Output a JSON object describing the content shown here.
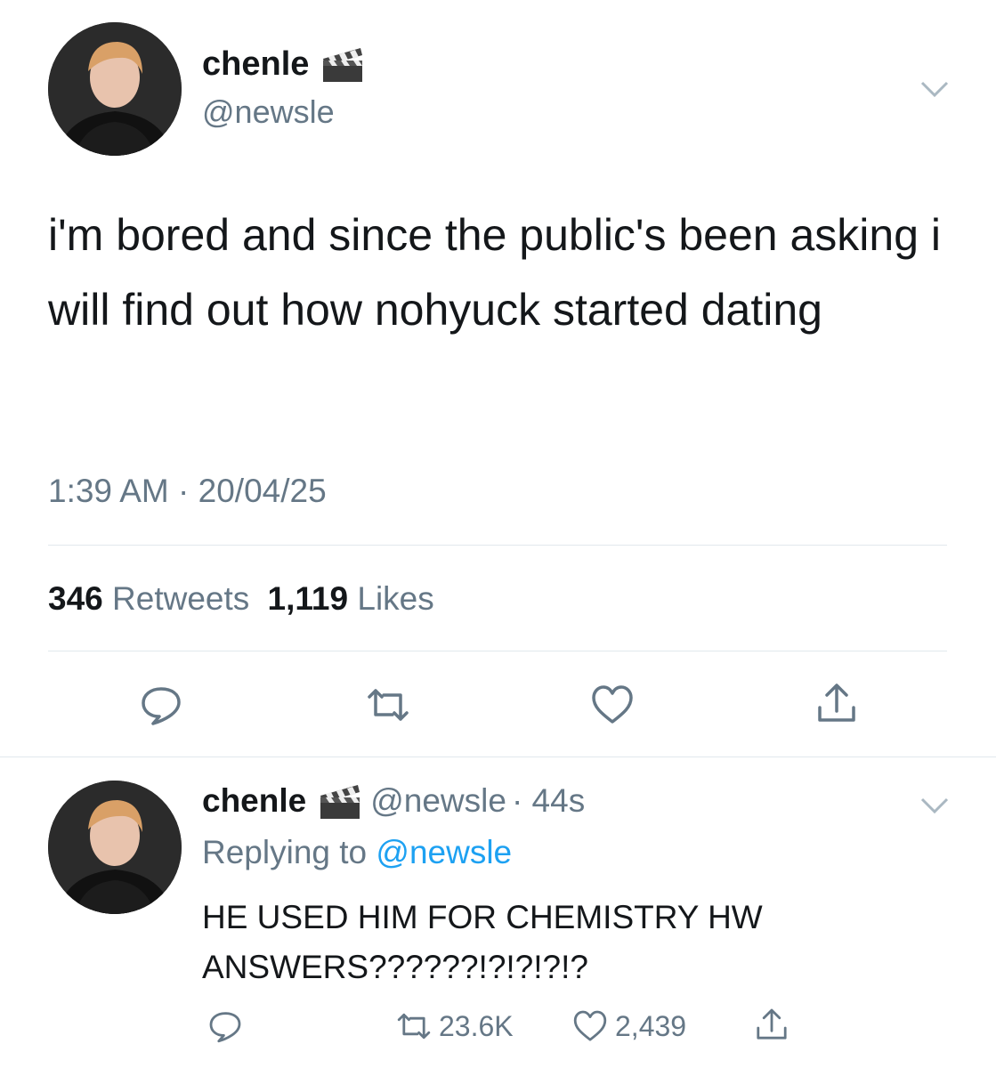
{
  "main_tweet": {
    "author_name": "chenle",
    "author_handle": "@newsle",
    "text": "i'm bored and since the public's been asking i will find out how nohyuck started dating",
    "timestamp": "1:39 AM · 20/04/25",
    "retweet_count": "346",
    "retweet_label": "Retweets",
    "like_count": "1,119",
    "like_label": "Likes",
    "icons": [
      "reply-icon",
      "retweet-icon",
      "like-icon",
      "share-icon",
      "clapperboard-icon",
      "chevron-down-icon"
    ]
  },
  "reply_tweet": {
    "author_name": "chenle",
    "author_handle": "@newsle",
    "time_ago": "· 44s",
    "replying_prefix": "Replying to",
    "replying_to": "@newsle",
    "text": "HE USED HIM FOR CHEMISTRY HW ANSWERS??????!?!?!?!?",
    "retweet_count": "23.6K",
    "like_count": "2,439"
  },
  "colors": {
    "text_primary": "#14171a",
    "text_secondary": "#657786",
    "link": "#1da1f2",
    "divider": "#e1e8ed",
    "icon": "#657786"
  }
}
